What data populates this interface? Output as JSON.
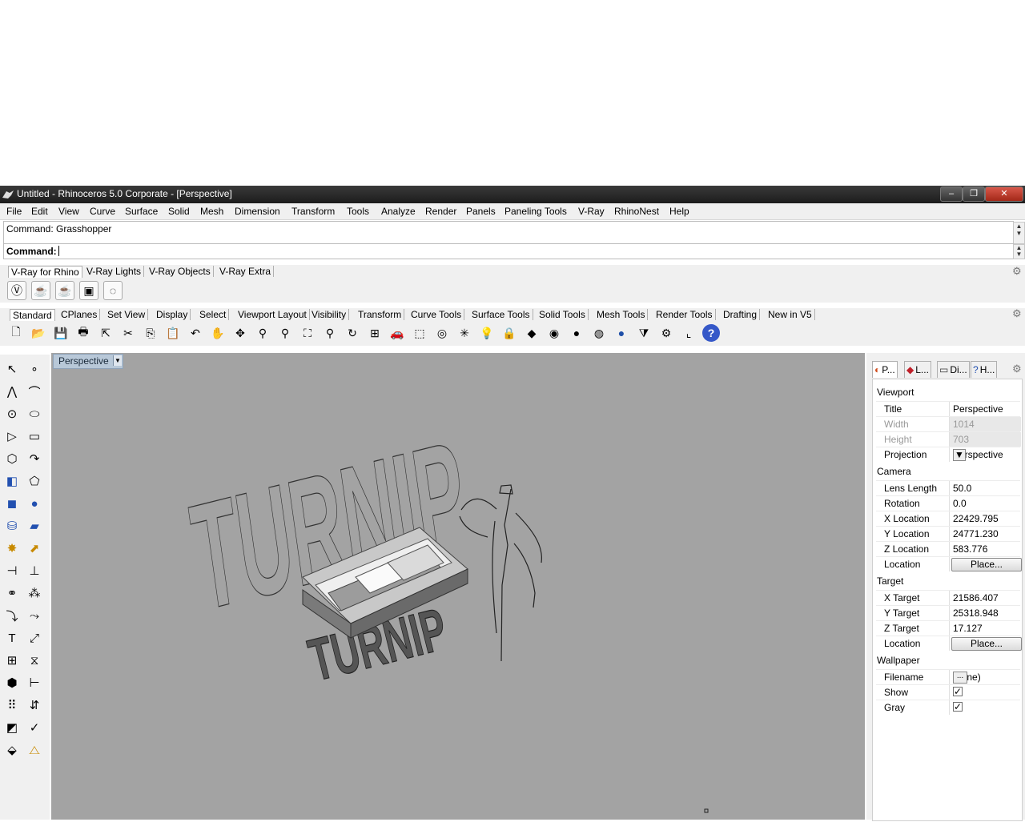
{
  "window": {
    "title": "Untitled - Rhinoceros  5.0 Corporate - [Perspective]",
    "minimize_label": "‒",
    "restore_label": "❐",
    "close_label": "✕"
  },
  "menu": [
    "File",
    "Edit",
    "View",
    "Curve",
    "Surface",
    "Solid",
    "Mesh",
    "Dimension",
    "Transform",
    "Tools",
    "Analyze",
    "Render",
    "Panels",
    "Paneling Tools",
    "V-Ray",
    "RhinoNest",
    "Help"
  ],
  "command": {
    "history": "Command: Grasshopper",
    "prompt": "Command:"
  },
  "vray_tabs": [
    "V-Ray for Rhino",
    "V-Ray Lights",
    "V-Ray Objects",
    "V-Ray Extra"
  ],
  "vray_icons": [
    "vray-logo-icon",
    "teapot-render-icon",
    "teapot-interactive-icon",
    "frame-buffer-icon",
    "vray-disabled-icon"
  ],
  "toolbar_tabs": [
    "Standard",
    "CPlanes",
    "Set View",
    "Display",
    "Select",
    "Viewport Layout",
    "Visibility",
    "Transform",
    "Curve Tools",
    "Surface Tools",
    "Solid Tools",
    "Mesh Tools",
    "Render Tools",
    "Drafting",
    "New in V5"
  ],
  "standard_icons": [
    {
      "name": "new-file-icon",
      "glyph": "🗋"
    },
    {
      "name": "open-folder-icon",
      "glyph": "📂"
    },
    {
      "name": "save-icon",
      "glyph": "💾"
    },
    {
      "name": "print-icon",
      "glyph": "🖶"
    },
    {
      "name": "export-icon",
      "glyph": "⇱"
    },
    {
      "name": "cut-icon",
      "glyph": "✂"
    },
    {
      "name": "copy-icon",
      "glyph": "⎘"
    },
    {
      "name": "paste-icon",
      "glyph": "📋"
    },
    {
      "name": "undo-icon",
      "glyph": "↶"
    },
    {
      "name": "pan-hand-icon",
      "glyph": "✋"
    },
    {
      "name": "rotate-view-icon",
      "glyph": "✥"
    },
    {
      "name": "zoom-icon",
      "glyph": "⚲"
    },
    {
      "name": "zoom-window-icon",
      "glyph": "⚲"
    },
    {
      "name": "zoom-extents-icon",
      "glyph": "⛶"
    },
    {
      "name": "zoom-selected-icon",
      "glyph": "⚲"
    },
    {
      "name": "rotate-camera-icon",
      "glyph": "↻"
    },
    {
      "name": "four-viewports-icon",
      "glyph": "⊞"
    },
    {
      "name": "car-icon",
      "glyph": "🚗"
    },
    {
      "name": "select-filter-icon",
      "glyph": "⬚"
    },
    {
      "name": "cplane-icon",
      "glyph": "◎"
    },
    {
      "name": "gumball-icon",
      "glyph": "✳"
    },
    {
      "name": "light-bulb-icon",
      "glyph": "💡"
    },
    {
      "name": "lock-icon",
      "glyph": "🔒"
    },
    {
      "name": "material-icon",
      "glyph": "◆"
    },
    {
      "name": "color-wheel-icon",
      "glyph": "◉"
    },
    {
      "name": "shaded-sphere-icon",
      "glyph": "●"
    },
    {
      "name": "render-sphere-icon",
      "glyph": "◍"
    },
    {
      "name": "blue-sphere-icon",
      "glyph": "●"
    },
    {
      "name": "filter-icon",
      "glyph": "⧩"
    },
    {
      "name": "options-gear-icon",
      "glyph": "⚙"
    },
    {
      "name": "dimension-icon",
      "glyph": "⌞"
    },
    {
      "name": "help-icon",
      "glyph": "?"
    }
  ],
  "left_tools": [
    {
      "name": "select-arrow-icon",
      "glyph": "↖"
    },
    {
      "name": "point-icon",
      "glyph": "∘"
    },
    {
      "name": "polyline-icon",
      "glyph": "⋀"
    },
    {
      "name": "curve-icon",
      "glyph": "⌒"
    },
    {
      "name": "circle-icon",
      "glyph": "⊙"
    },
    {
      "name": "ellipse-icon",
      "glyph": "⬭"
    },
    {
      "name": "polygon-icon",
      "glyph": "▷"
    },
    {
      "name": "rectangle-icon",
      "glyph": "▭"
    },
    {
      "name": "hexagon-icon",
      "glyph": "⬡"
    },
    {
      "name": "arc-icon",
      "glyph": "↷"
    },
    {
      "name": "surface-icon",
      "glyph": "◧"
    },
    {
      "name": "extrude-icon",
      "glyph": "⬠"
    },
    {
      "name": "box-icon",
      "glyph": "◼"
    },
    {
      "name": "sphere-union-icon",
      "glyph": "●"
    },
    {
      "name": "cylinder-icon",
      "glyph": "⛁"
    },
    {
      "name": "plane-icon",
      "glyph": "▰"
    },
    {
      "name": "explode-icon",
      "glyph": "✸"
    },
    {
      "name": "arrow-tool-icon",
      "glyph": "⬈"
    },
    {
      "name": "split-icon",
      "glyph": "⊣"
    },
    {
      "name": "trim-icon",
      "glyph": "⊥"
    },
    {
      "name": "boolean-icon",
      "glyph": "⚭"
    },
    {
      "name": "group-icon",
      "glyph": "⁂"
    },
    {
      "name": "fillet-icon",
      "glyph": "⤵"
    },
    {
      "name": "offset-icon",
      "glyph": "⤳"
    },
    {
      "name": "text-icon",
      "glyph": "T"
    },
    {
      "name": "scale-icon",
      "glyph": "⤢"
    },
    {
      "name": "array-icon",
      "glyph": "⊞"
    },
    {
      "name": "mirror-icon",
      "glyph": "⧖"
    },
    {
      "name": "block-icon",
      "glyph": "⬢"
    },
    {
      "name": "dimension-tool-icon",
      "glyph": "⊢"
    },
    {
      "name": "grid-array-icon",
      "glyph": "⠿"
    },
    {
      "name": "gumball-tool-icon",
      "glyph": "⇵"
    },
    {
      "name": "analyze-icon",
      "glyph": "◩"
    },
    {
      "name": "check-icon",
      "glyph": "✓"
    },
    {
      "name": "mesh-icon",
      "glyph": "⬙"
    },
    {
      "name": "render-tool-icon",
      "glyph": "⧍"
    }
  ],
  "viewport": {
    "label": "Perspective",
    "scene_text_front": "TURNIP",
    "scene_text_back": "TURNIP"
  },
  "panel_tabs": [
    {
      "name": "properties-tab",
      "glyph": "◐",
      "label": "P..."
    },
    {
      "name": "layers-tab",
      "glyph": "◆",
      "label": "L..."
    },
    {
      "name": "display-tab",
      "glyph": "▭",
      "label": "Di..."
    },
    {
      "name": "help-tab",
      "glyph": "?",
      "label": "H..."
    }
  ],
  "properties": {
    "viewport_title": "Viewport",
    "title_label": "Title",
    "title_value": "Perspective",
    "width_label": "Width",
    "width_value": "1014",
    "height_label": "Height",
    "height_value": "703",
    "projection_label": "Projection",
    "projection_value": "Perspective",
    "camera_title": "Camera",
    "lens_label": "Lens Length",
    "lens_value": "50.0",
    "rotation_label": "Rotation",
    "rotation_value": "0.0",
    "xloc_label": "X Location",
    "xloc_value": "22429.795",
    "yloc_label": "Y Location",
    "yloc_value": "24771.230",
    "zloc_label": "Z Location",
    "zloc_value": "583.776",
    "location_label": "Location",
    "place_label": "Place...",
    "target_title": "Target",
    "xtarget_label": "X Target",
    "xtarget_value": "21586.407",
    "ytarget_label": "Y Target",
    "ytarget_value": "25318.948",
    "ztarget_label": "Z Target",
    "ztarget_value": "17.127",
    "tlocation_label": "Location",
    "tplace_label": "Place...",
    "wallpaper_title": "Wallpaper",
    "filename_label": "Filename",
    "filename_value": "(none)",
    "browse_label": "...",
    "show_label": "Show",
    "gray_label": "Gray",
    "check_mark": "✓"
  }
}
